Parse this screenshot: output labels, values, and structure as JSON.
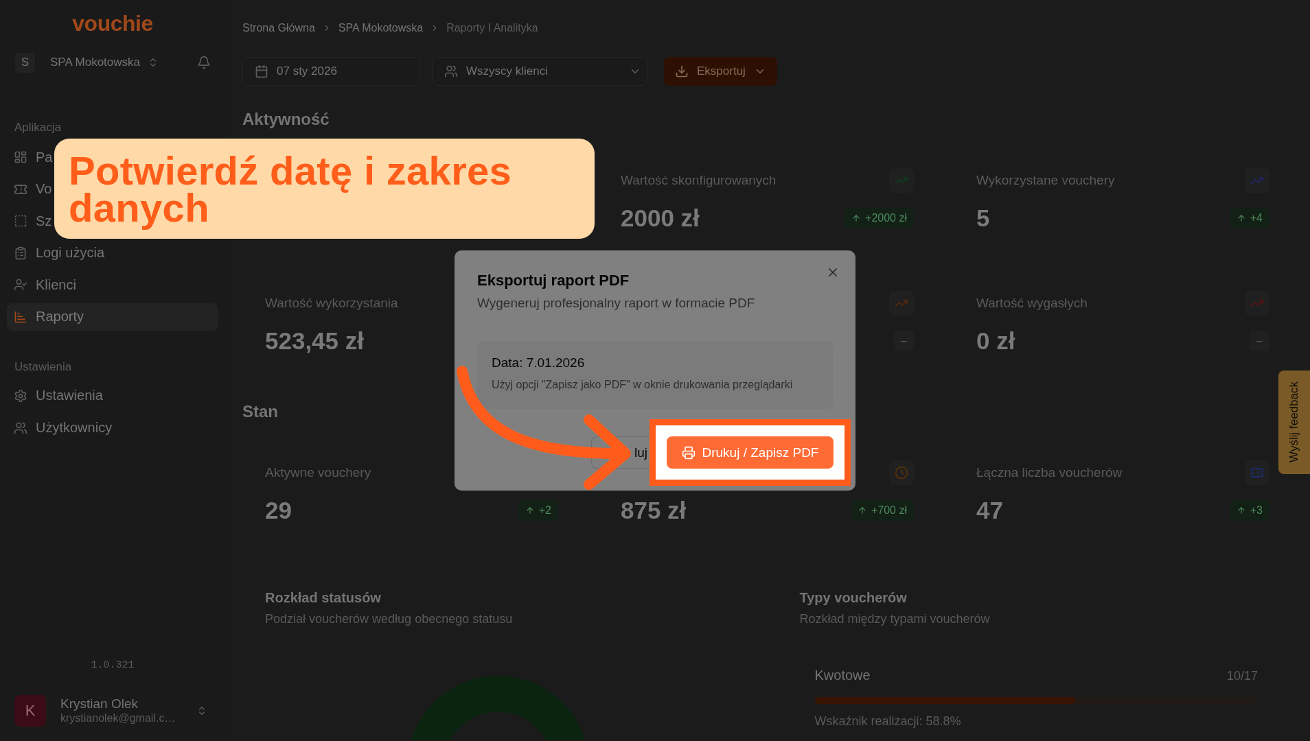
{
  "sidebar": {
    "logo": "vouchie",
    "organization": {
      "initial": "S",
      "name": "SPA Mokotowska"
    },
    "sections": [
      {
        "title": "Aplikacja",
        "items": [
          {
            "label": "Pa",
            "selected": false
          },
          {
            "label": "Vo",
            "selected": false
          },
          {
            "label": "Sz",
            "selected": false
          },
          {
            "label": "Logi użycia",
            "selected": false
          },
          {
            "label": "Klienci",
            "selected": false
          },
          {
            "label": "Raporty",
            "selected": true
          }
        ]
      },
      {
        "title": "Ustawienia",
        "items": [
          {
            "label": "Ustawienia",
            "selected": false
          },
          {
            "label": "Użytkownicy",
            "selected": false
          }
        ]
      }
    ],
    "version": "1.0.321",
    "user": {
      "initial": "K",
      "name": "Krystian Olek",
      "email": "krystianolek@gmail.c…"
    }
  },
  "breadcrumb": [
    {
      "label": "Strona Główna",
      "current": false
    },
    {
      "label": "SPA Mokotowska",
      "current": false
    },
    {
      "label": "Raporty I Analityka",
      "current": true
    }
  ],
  "toolbar": {
    "date_picker": "07 sty 2026",
    "client_filter": "Wszyscy klienci",
    "export_button": "Eksportuj"
  },
  "sections": [
    {
      "title": "Aktywność",
      "cards": [
        {
          "label": "Wartość skonfigurowanych",
          "value": "2000 zł",
          "color": "#0f3d20",
          "badge": {
            "kind": "up",
            "text": "+2000 zł"
          }
        },
        {
          "label": "Wykorzystane vouchery",
          "value": "5",
          "color": "#23256b",
          "badge": {
            "kind": "up",
            "text": "+4"
          }
        },
        {
          "label": "Wartość wykorzystania",
          "value": "523,45 zł"
        },
        {
          "color": "#5a2a0c",
          "badge": {
            "kind": "flat",
            "text": "–"
          }
        },
        {
          "label": "Wartość wygasłych",
          "value": "0 zł",
          "color": "#5a1414",
          "badge": {
            "kind": "flat",
            "text": "–"
          }
        }
      ]
    },
    {
      "title": "Stan",
      "cards": [
        {
          "label": "Aktywne vouchery",
          "value": "29",
          "badge": {
            "kind": "up",
            "text": "+2"
          }
        },
        {
          "value": "875 zł",
          "color": "#5a3208",
          "badge": {
            "kind": "up",
            "text": "+700 zł"
          }
        },
        {
          "label": "Łączna liczba voucherów",
          "value": "47",
          "color": "#1c2a6e",
          "badge": {
            "kind": "up",
            "text": "+3"
          }
        }
      ]
    }
  ],
  "charts": [
    {
      "kind": "donut",
      "title": "Rozkład statusów",
      "subtitle": "Podział voucherów według obecnego statusu"
    },
    {
      "kind": "bars",
      "title": "Typy voucherów",
      "subtitle": "Rozkład między typami voucherów",
      "types": [
        {
          "name": "Kwotowe",
          "count": "10/17",
          "level": 0.588,
          "rate": "Wskaźnik realizacji: 58.8%"
        }
      ]
    }
  ],
  "modal": {
    "title": "Eksportuj raport PDF",
    "subtitle": "Wygeneruj profesjonalny raport w formacie PDF",
    "date": "Data: 7.01.2026",
    "hint": "Użyj opcji \"Zapisz jako PDF\" w oknie drukowania przeglądarki",
    "cancel_button": "luj",
    "print_button": "Drukuj / Zapisz PDF"
  },
  "callout": {
    "text": "Potwierdź datę i zakres danych"
  },
  "feedback_tab": "Wyślij feedback"
}
